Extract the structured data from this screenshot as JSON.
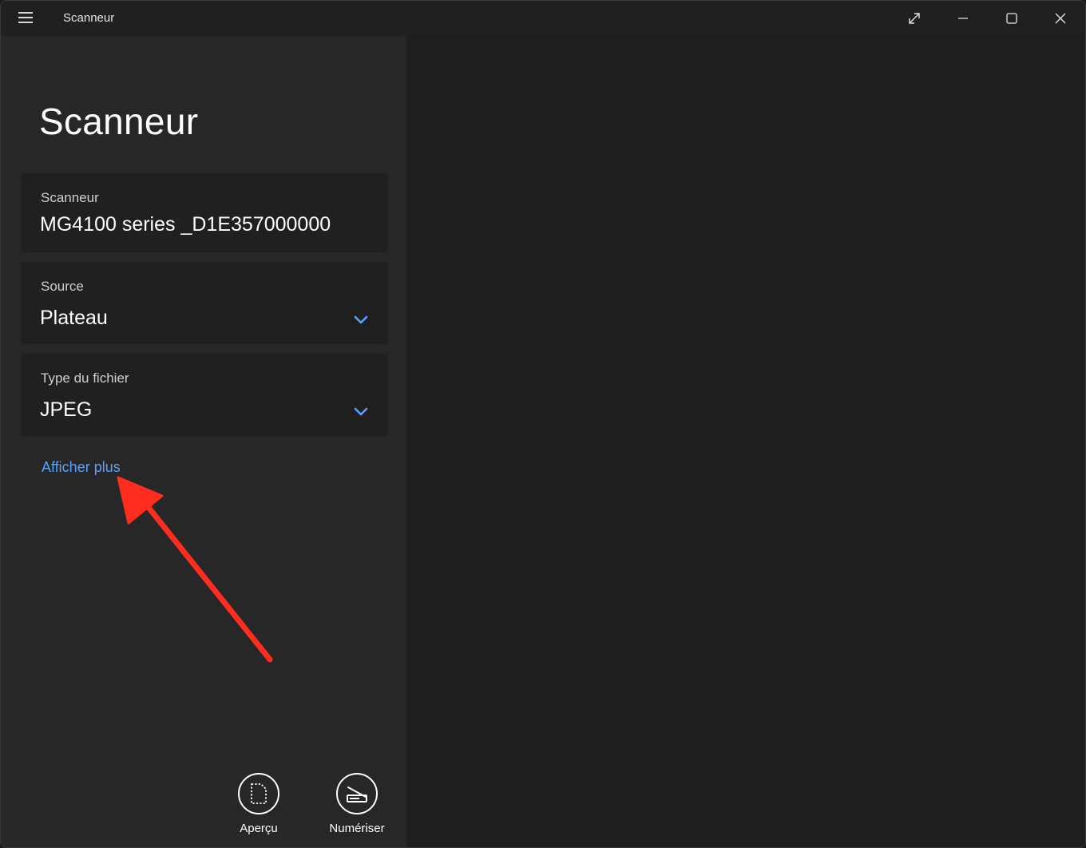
{
  "window": {
    "title": "Scanneur",
    "controls": [
      "fullscreen-icon",
      "minimize-icon",
      "maximize-icon",
      "close-icon"
    ]
  },
  "page": {
    "title": "Scanneur"
  },
  "fields": {
    "scanner": {
      "label": "Scanneur",
      "value": "MG4100 series _D1E357000000"
    },
    "source": {
      "label": "Source",
      "value": "Plateau"
    },
    "file_type": {
      "label": "Type du fichier",
      "value": "JPEG"
    }
  },
  "show_more_label": "Afficher plus",
  "actions": {
    "preview_label": "Aperçu",
    "scan_label": "Numériser"
  },
  "colors": {
    "accent": "#5aa0ff",
    "annotation_arrow": "#ff2d20"
  }
}
